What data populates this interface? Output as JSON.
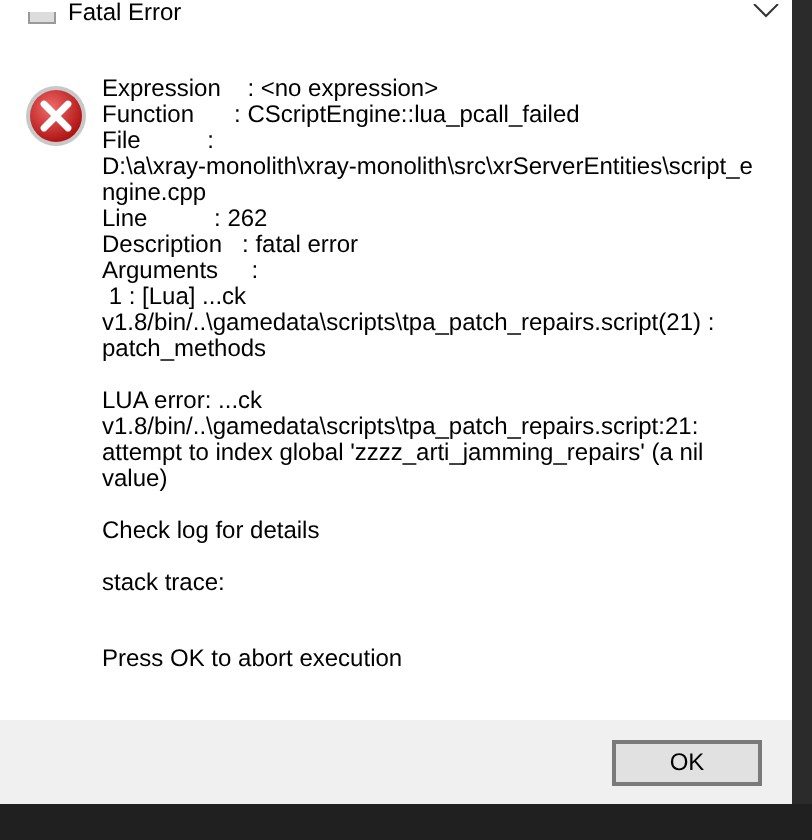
{
  "window": {
    "title": "Fatal Error"
  },
  "message": {
    "paragraphs": [
      {
        "kind": "text",
        "lines": [
          "Expression    : <no expression>",
          "Function      : CScriptEngine::lua_pcall_failed",
          "File          :",
          "D:\\a\\xray-monolith\\xray-monolith\\src\\xrServerEntities\\script_e",
          "ngine.cpp",
          "Line          : 262",
          "Description   : fatal error",
          "Arguments     :",
          " 1 : [Lua] ...ck",
          "v1.8/bin/..\\gamedata\\scripts\\tpa_patch_repairs.script(21) :",
          "patch_methods"
        ]
      },
      {
        "kind": "text",
        "lines": [
          "LUA error: ...ck",
          "v1.8/bin/..\\gamedata\\scripts\\tpa_patch_repairs.script:21:",
          "attempt to index global 'zzzz_arti_jamming_repairs' (a nil",
          "value)"
        ]
      },
      {
        "kind": "text",
        "lines": [
          "Check log for details"
        ]
      },
      {
        "kind": "text",
        "lines": [
          "stack trace:"
        ]
      },
      {
        "kind": "prompt",
        "lines": [
          "Press OK to abort execution"
        ]
      }
    ]
  },
  "buttons": [
    {
      "label": "OK",
      "default": true
    }
  ]
}
